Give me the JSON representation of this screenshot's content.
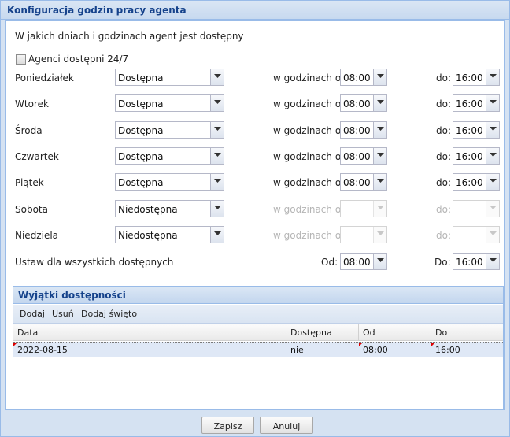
{
  "window": {
    "title": "Konfiguracja godzin pracy agenta"
  },
  "section_title": "W jakich dniach i godzinach agent jest dostępny",
  "always_available": {
    "label": "Agenci dostępni 24/7",
    "checked": false
  },
  "labels": {
    "from": "w godzinach od:",
    "to": "do:"
  },
  "days": [
    {
      "name": "Poniedziałek",
      "status": "Dostępna",
      "from": "08:00",
      "to": "16:00",
      "enabled": true
    },
    {
      "name": "Wtorek",
      "status": "Dostępna",
      "from": "08:00",
      "to": "16:00",
      "enabled": true
    },
    {
      "name": "Środa",
      "status": "Dostępna",
      "from": "08:00",
      "to": "16:00",
      "enabled": true
    },
    {
      "name": "Czwartek",
      "status": "Dostępna",
      "from": "08:00",
      "to": "16:00",
      "enabled": true
    },
    {
      "name": "Piątek",
      "status": "Dostępna",
      "from": "08:00",
      "to": "16:00",
      "enabled": true
    },
    {
      "name": "Sobota",
      "status": "Niedostępna",
      "from": "",
      "to": "",
      "enabled": false
    },
    {
      "name": "Niedziela",
      "status": "Niedostępna",
      "from": "",
      "to": "",
      "enabled": false
    }
  ],
  "set_all": {
    "label": "Ustaw dla wszystkich dostępnych",
    "from_label": "Od:",
    "from": "08:00",
    "to_label": "Do:",
    "to": "16:00"
  },
  "exceptions": {
    "title": "Wyjątki dostępności",
    "toolbar": {
      "add": "Dodaj",
      "remove": "Usuń",
      "add_holiday": "Dodaj święto"
    },
    "columns": [
      "Data",
      "Dostępna",
      "Od",
      "Do"
    ],
    "rows": [
      {
        "date": "2022-08-15",
        "available": "nie",
        "from": "08:00",
        "to": "16:00"
      }
    ]
  },
  "buttons": {
    "save": "Zapisz",
    "cancel": "Anuluj"
  },
  "colors": {
    "title": "#15428b",
    "border": "#99bbe8",
    "selected_row": "#dfe8f6",
    "dirty_marker": "#dd0000"
  }
}
